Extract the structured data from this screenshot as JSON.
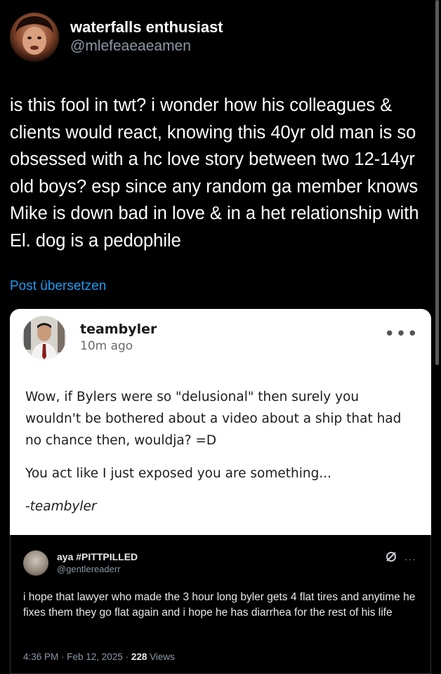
{
  "tweet": {
    "display_name": "waterfalls enthusiast",
    "handle": "@mlefeaeaeamen",
    "text": "is this fool in twt? i wonder how his colleagues & clients would react, knowing this 40yr old man is so obsessed with a hc love story between two 12-14yr old boys? esp since any random ga member knows Mike is down bad in love & in a het relationship with El. dog is a pedophile",
    "translate_label": "Post übersetzen"
  },
  "embedded_post": {
    "username": "teambyler",
    "time": "10m ago",
    "more_icon": "more-dots-icon",
    "paragraphs": [
      "Wow, if Bylers were so \"delusional\" then surely you wouldn't be bothered about a video about a ship that had no chance then, wouldja? =D",
      "You act like I just exposed you are something..."
    ],
    "signature": "-teambyler"
  },
  "quoted_tweet": {
    "display_name": "aya #PITTPILLED",
    "handle": "@gentlereaderr",
    "text": "i hope that lawyer who made the 3 hour long byler gets 4 flat tires and anytime he fixes them they go flat again and i hope he has diarrhea for the rest of his life",
    "time": "4:36 PM · Feb 12, 2025 · ",
    "views_count": "228",
    "views_label": " Views",
    "icons": [
      "grok-icon",
      "more-dots-icon"
    ]
  },
  "colors": {
    "background": "#000000",
    "link": "#1d9bf0",
    "secondary_text": "#8b98a5"
  }
}
